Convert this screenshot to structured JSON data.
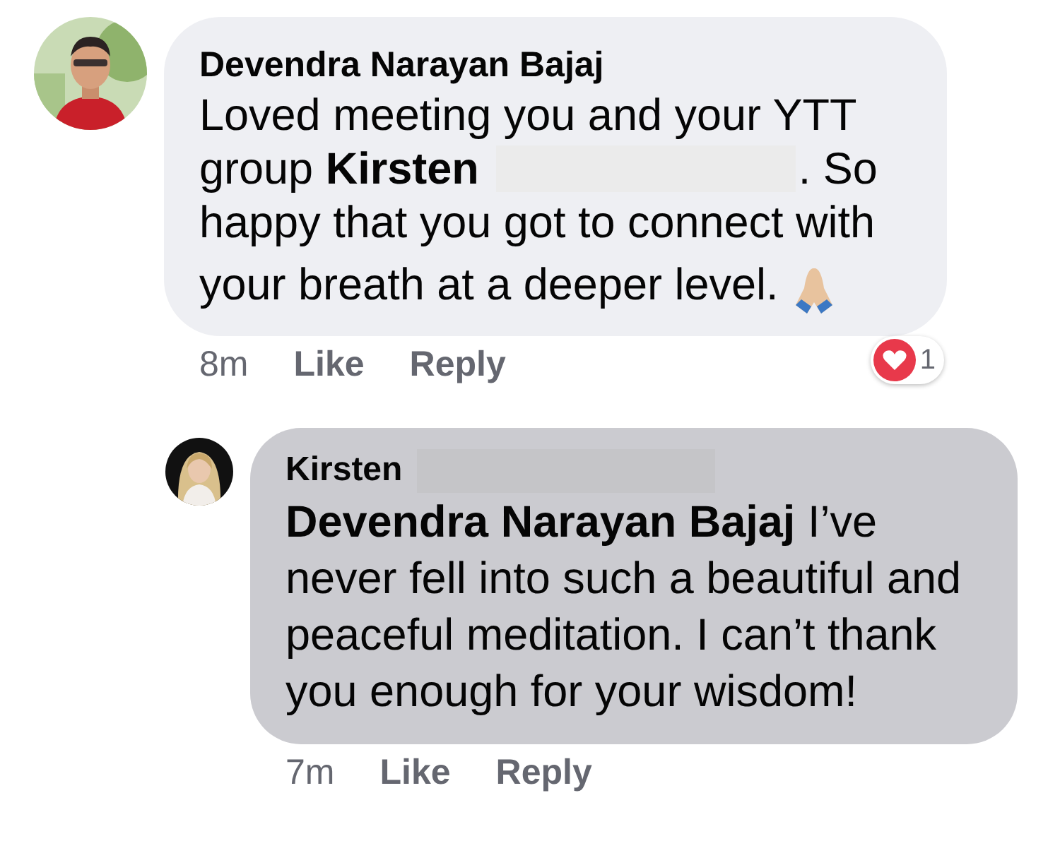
{
  "comments": [
    {
      "author": "Devendra Narayan Bajaj",
      "author_redacted": false,
      "reply": false,
      "highlighted": false,
      "lines": [
        [
          {
            "kind": "text",
            "text": "Loved meeting you and your YTT"
          }
        ],
        [
          {
            "kind": "text",
            "text": "group **Kirsten**"
          },
          {
            "kind": "redaction"
          },
          {
            "kind": "text",
            "text": ". So"
          }
        ],
        [
          {
            "kind": "text",
            "text": "happy that you got to connect with"
          }
        ],
        [
          {
            "kind": "text",
            "text": "your breath at a deeper level."
          },
          {
            "kind": "emoji"
          }
        ]
      ],
      "time": "8m",
      "actions": [
        "Like",
        "Reply"
      ],
      "reaction": {
        "count": "1"
      }
    },
    {
      "author": "Kirsten",
      "author_redacted": true,
      "reply": true,
      "highlighted": true,
      "lines": [
        [
          {
            "kind": "text",
            "text": "**Devendra Narayan Bajaj** I’ve never fell into such a beautiful and peaceful meditation. I can’t thank you enough for your wisdom!"
          }
        ]
      ],
      "time": "7m",
      "actions": [
        "Like",
        "Reply"
      ]
    }
  ]
}
